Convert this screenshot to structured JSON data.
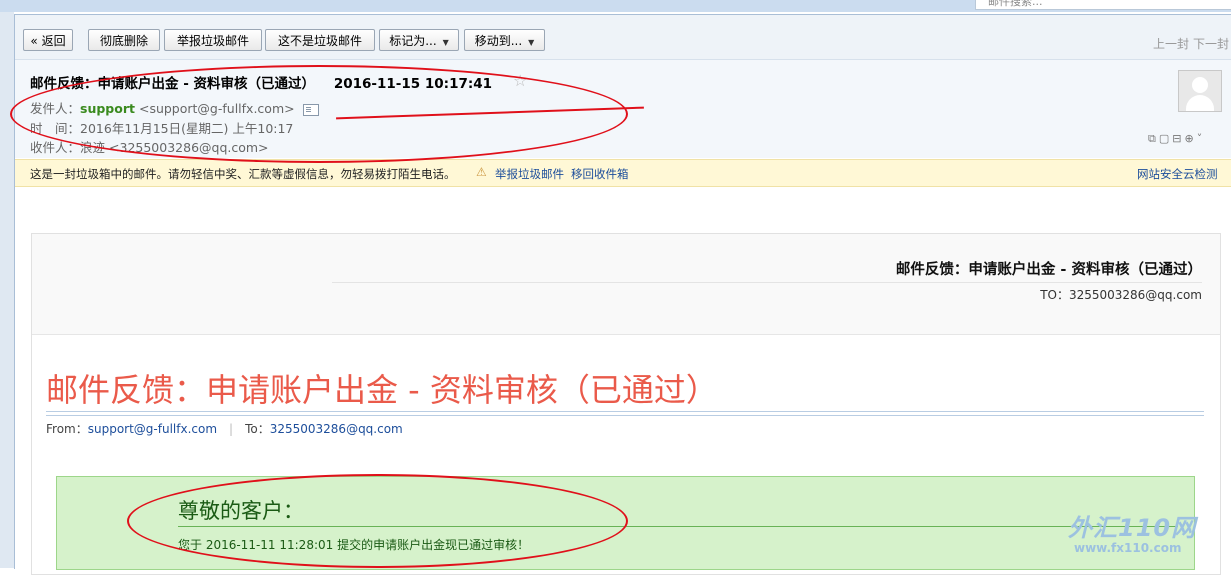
{
  "top_search": {
    "placeholder": "邮件搜索..."
  },
  "toolbar": {
    "back": "« 返回",
    "delete_forever": "彻底删除",
    "report_spam": "举报垃圾邮件",
    "not_spam": "这不是垃圾邮件",
    "mark_as": "标记为...",
    "move_to": "移动到...",
    "prev": "上一封",
    "next": "下一封"
  },
  "header": {
    "subject": "邮件反馈：申请账户出金 - 资料审核（已通过）",
    "datetime": "2016-11-15 10:17:41",
    "from_label": "发件人：",
    "sender_name": "support",
    "sender_addr": "<support@g-fullfx.com>",
    "time_label": "时　间：",
    "time_value": "2016年11月15日(星期二) 上午10:17",
    "to_label": "收件人：",
    "to_name": "浪迹",
    "to_addr": "<3255003286@qq.com>"
  },
  "warning": {
    "text": "这是一封垃圾箱中的邮件。请勿轻信中奖、汇款等虚假信息，勿轻易拨打陌生电话。",
    "report_link": "举报垃圾邮件",
    "move_back_link": "移回收件箱",
    "security_link": "网站安全云检测"
  },
  "body": {
    "card_title": "邮件反馈：申请账户出金 - 资料审核（已通过）",
    "card_to": "TO：3255003286@qq.com",
    "big_title": "邮件反馈：申请账户出金 - 资料审核（已通过）",
    "from_label": "From：",
    "from_value": "support@g-fullfx.com",
    "to_label": "To：",
    "to_value": "3255003286@qq.com",
    "greeting": "尊敬的客户：",
    "notice": "您于 2016-11-11 11:28:01 提交的申请账户出金现已通过审核！"
  },
  "watermark": {
    "main": "外汇110网",
    "sub": "www.fx110.com"
  },
  "colors": {
    "accent_red": "#e0101a",
    "title_red": "#ea5a4a",
    "green_box": "#d6f2cb",
    "sender_green": "#3a8a1e",
    "link_blue": "#1d4e9b"
  }
}
